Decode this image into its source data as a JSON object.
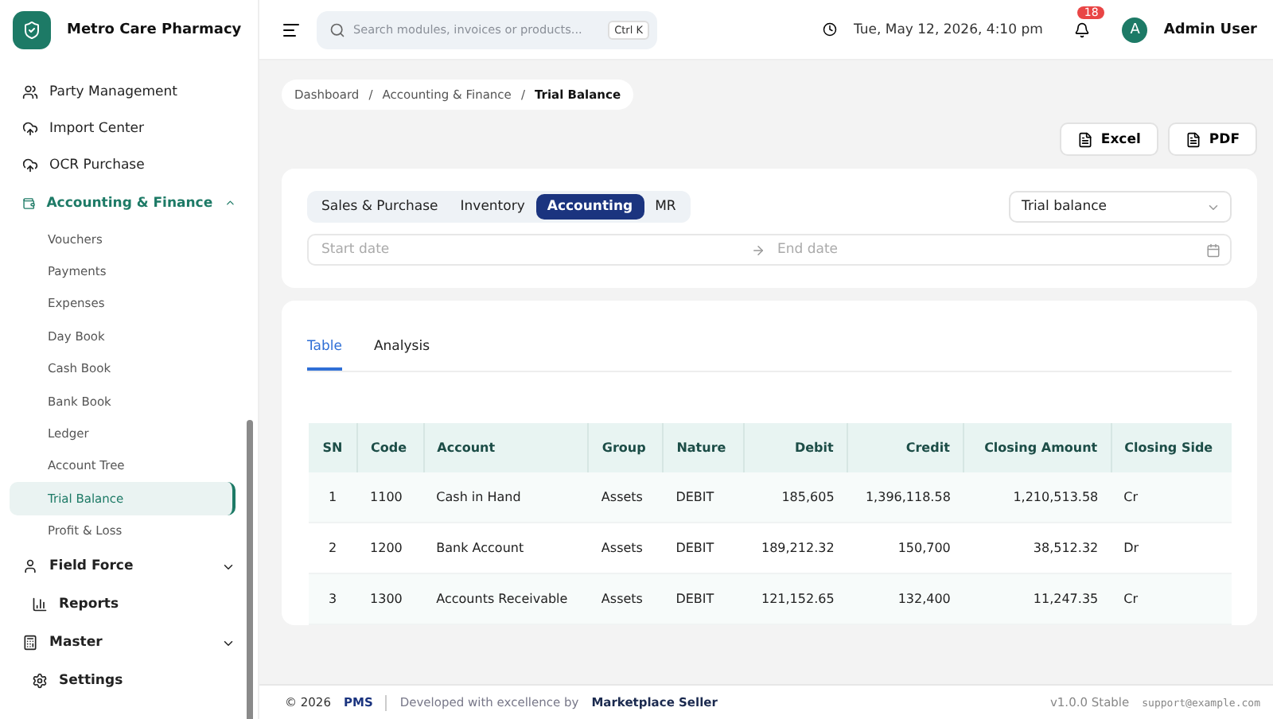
{
  "brand": {
    "name": "Metro Care Pharmacy"
  },
  "sidebar": {
    "items": [
      {
        "kind": "link",
        "label": "Party Management"
      },
      {
        "kind": "link",
        "label": "Import Center"
      },
      {
        "kind": "link",
        "label": "OCR Purchase"
      },
      {
        "kind": "group",
        "label": "Accounting & Finance",
        "expanded": true,
        "children": [
          {
            "label": "Vouchers",
            "selected": false
          },
          {
            "label": "Payments",
            "selected": false
          },
          {
            "label": "Expenses",
            "selected": false
          },
          {
            "label": "Day Book",
            "selected": false
          },
          {
            "label": "Cash Book",
            "selected": false
          },
          {
            "label": "Bank Book",
            "selected": false
          },
          {
            "label": "Ledger",
            "selected": false
          },
          {
            "label": "Account Tree",
            "selected": false
          },
          {
            "label": "Trial Balance",
            "selected": true
          },
          {
            "label": "Profit & Loss",
            "selected": false
          }
        ]
      },
      {
        "kind": "group",
        "label": "Field Force",
        "expanded": false
      },
      {
        "kind": "link",
        "label": "Reports"
      },
      {
        "kind": "group",
        "label": "Master",
        "expanded": false
      },
      {
        "kind": "link",
        "label": "Settings"
      }
    ]
  },
  "topbar": {
    "search": {
      "placeholder": "Search modules, invoices or products...",
      "shortcut": "Ctrl K"
    },
    "datetime": "Tue, May 12, 2026, 4:10 pm",
    "notifications": "18",
    "user": {
      "initial": "A",
      "name": "Admin User"
    }
  },
  "breadcrumb": {
    "separator": "/",
    "items": [
      {
        "label": "Dashboard",
        "current": false
      },
      {
        "label": "Accounting & Finance",
        "current": false
      },
      {
        "label": "Trial Balance",
        "current": true
      }
    ]
  },
  "export_buttons": [
    "Excel",
    "PDF"
  ],
  "filters": {
    "segments": [
      {
        "label": "Sales & Purchase",
        "selected": false
      },
      {
        "label": "Inventory",
        "selected": false
      },
      {
        "label": "Accounting",
        "selected": true
      },
      {
        "label": "MR",
        "selected": false
      }
    ],
    "report_select": "Trial balance",
    "start_placeholder": "Start date",
    "end_placeholder": "End date"
  },
  "tabs": [
    {
      "label": "Table",
      "selected": true
    },
    {
      "label": "Analysis",
      "selected": false
    }
  ],
  "table": {
    "columns": [
      "SN",
      "Code",
      "Account",
      "Group",
      "Nature",
      "Debit",
      "Credit",
      "Closing Amount",
      "Closing Side"
    ],
    "rows": [
      [
        "1",
        "1100",
        "Cash in Hand",
        "Assets",
        "DEBIT",
        "185,605",
        "1,396,118.58",
        "1,210,513.58",
        "Cr"
      ],
      [
        "2",
        "1200",
        "Bank Account",
        "Assets",
        "DEBIT",
        "189,212.32",
        "150,700",
        "38,512.32",
        "Dr"
      ],
      [
        "3",
        "1300",
        "Accounts Receivable",
        "Assets",
        "DEBIT",
        "121,152.65",
        "132,400",
        "11,247.35",
        "Cr"
      ]
    ]
  },
  "footer": {
    "year": "© 2026",
    "product": "PMS",
    "credit_prefix": "Developed with excellence by",
    "credit_name": "Marketplace Seller",
    "version": "v1.0.0 Stable",
    "email": "support@example.com"
  }
}
